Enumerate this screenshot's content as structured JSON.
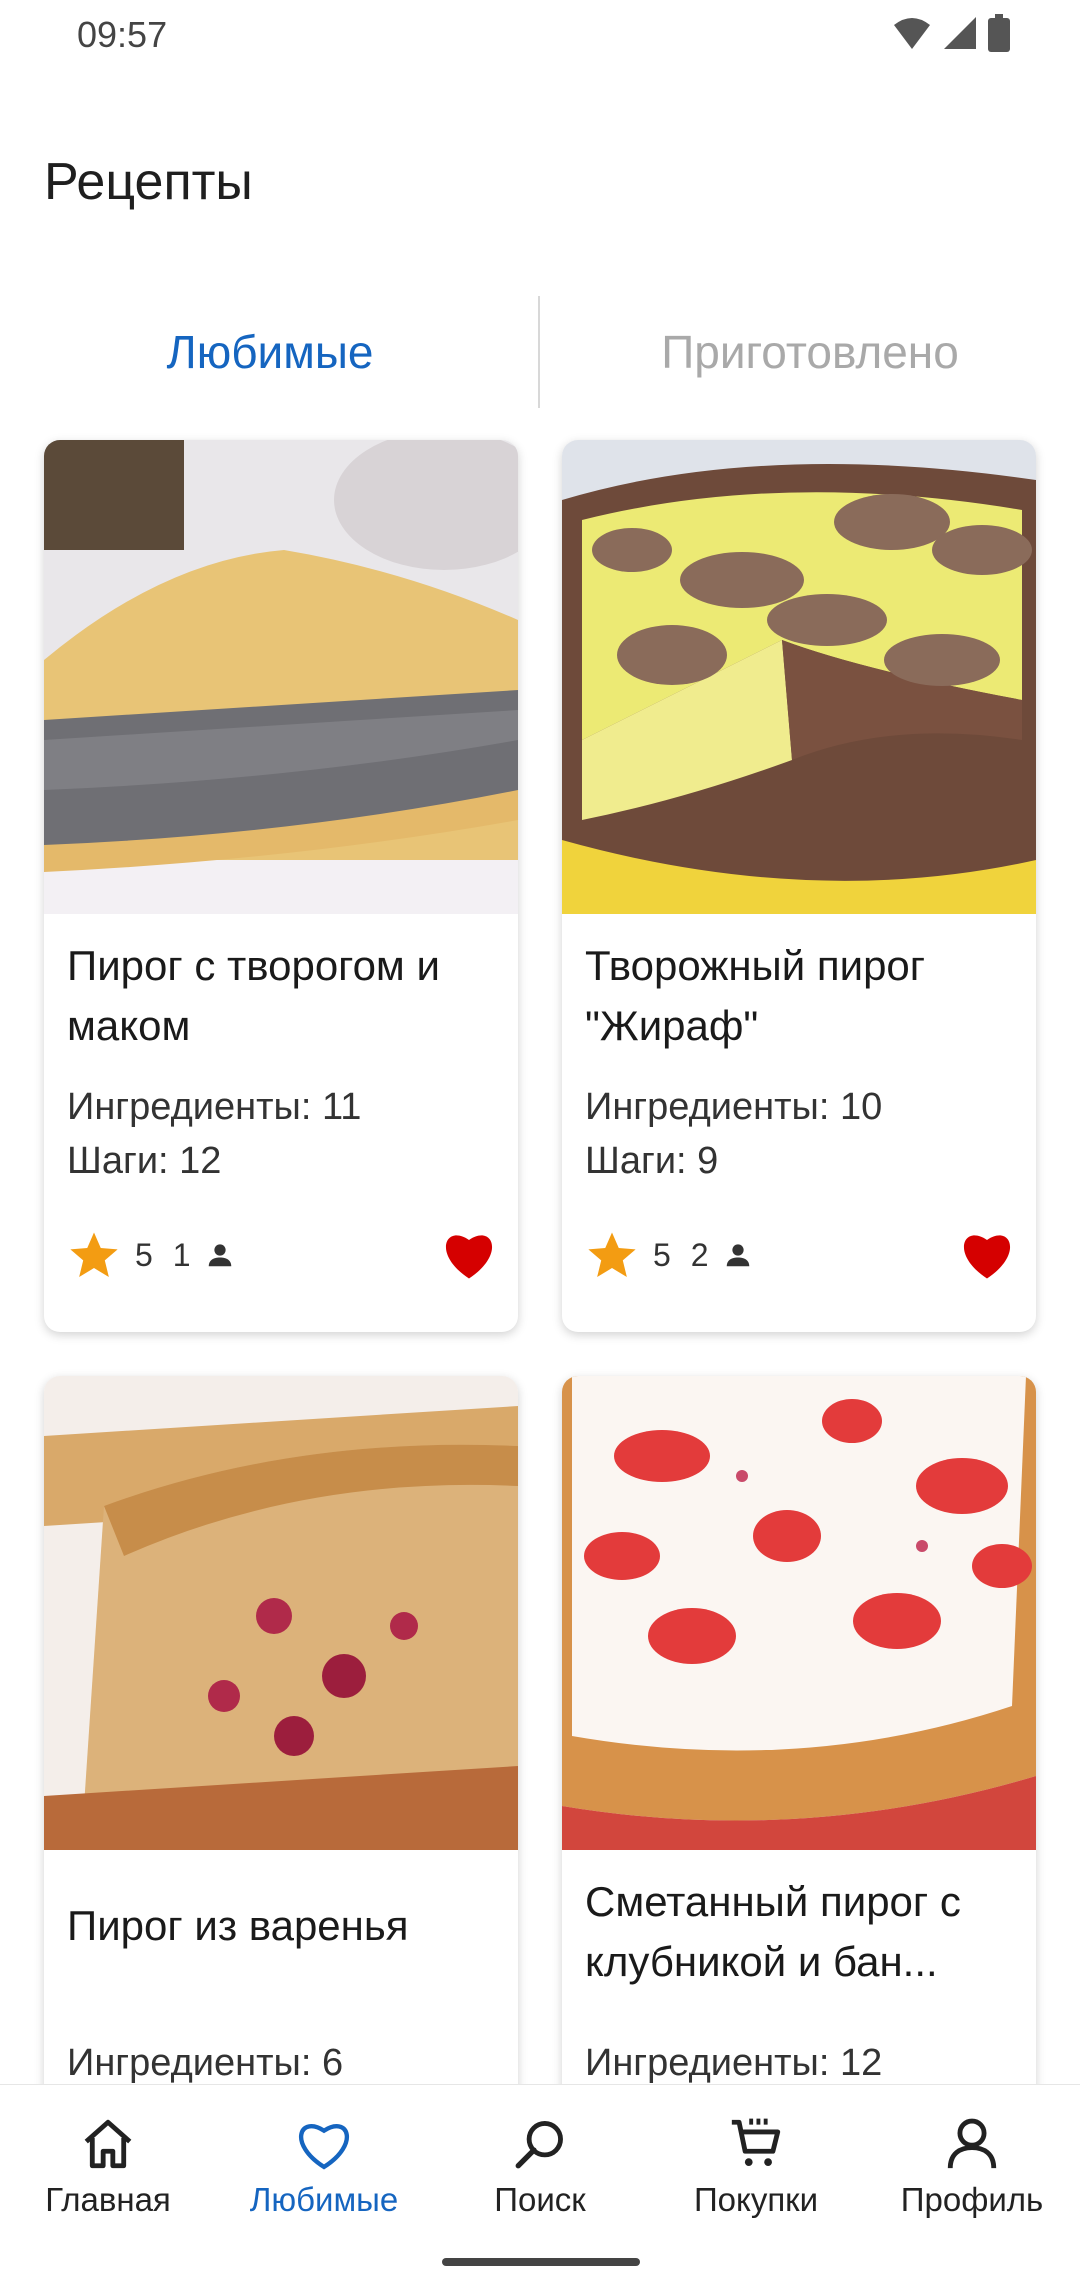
{
  "status_bar": {
    "time": "09:57",
    "icons": [
      "wifi-icon",
      "signal-icon",
      "battery-icon"
    ]
  },
  "page": {
    "title": "Рецепты"
  },
  "tabs": [
    {
      "label": "Любимые",
      "active": true
    },
    {
      "label": "Приготовлено",
      "active": false
    }
  ],
  "recipes": [
    {
      "title": "Пирог с творогом и маком",
      "ingredients": "Ингредиенты: 11",
      "steps": "Шаги: 12",
      "rating": "5",
      "people": "1",
      "favorite": true
    },
    {
      "title": "Творожный пирог \"Жираф\"",
      "ingredients": "Ингредиенты: 10",
      "steps": "Шаги: 9",
      "rating": "5",
      "people": "2",
      "favorite": true
    },
    {
      "title": "Пирог из варенья",
      "ingredients": "Ингредиенты: 6",
      "steps": "",
      "rating": "",
      "people": "",
      "favorite": true
    },
    {
      "title": "Сметанный пирог с клубникой и бан...",
      "ingredients": "Ингредиенты: 12",
      "steps": "",
      "rating": "",
      "people": "",
      "favorite": true
    }
  ],
  "nav": [
    {
      "label": "Главная",
      "icon": "home-icon"
    },
    {
      "label": "Любимые",
      "icon": "heart-icon",
      "active": true
    },
    {
      "label": "Поиск",
      "icon": "search-icon"
    },
    {
      "label": "Покупки",
      "icon": "cart-icon"
    },
    {
      "label": "Профиль",
      "icon": "profile-icon"
    }
  ],
  "colors": {
    "accent": "#1565c0",
    "heart": "#d50000",
    "star": "#f39c12",
    "inactive_tab": "#a9a9a9"
  }
}
